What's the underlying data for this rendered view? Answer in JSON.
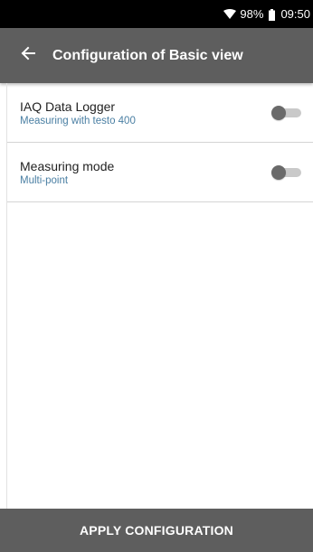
{
  "status_bar": {
    "battery_percent": "98%",
    "time": "09:50",
    "icons": [
      "wifi-icon",
      "battery-icon"
    ]
  },
  "app_bar": {
    "back_icon": "arrow-left-icon",
    "title": "Configuration of Basic view"
  },
  "settings": {
    "items": [
      {
        "title": "IAQ Data Logger",
        "subtitle": "Measuring with testo 400",
        "toggle_on": false
      },
      {
        "title": "Measuring mode",
        "subtitle": "Multi-point",
        "toggle_on": false
      }
    ]
  },
  "footer": {
    "apply_label": "APPLY CONFIGURATION"
  },
  "colors": {
    "status_bar_bg": "#000000",
    "app_bar_bg": "#5e5e5e",
    "subtitle_text": "#4a7fa3",
    "footer_bg": "#5e5e5e"
  }
}
